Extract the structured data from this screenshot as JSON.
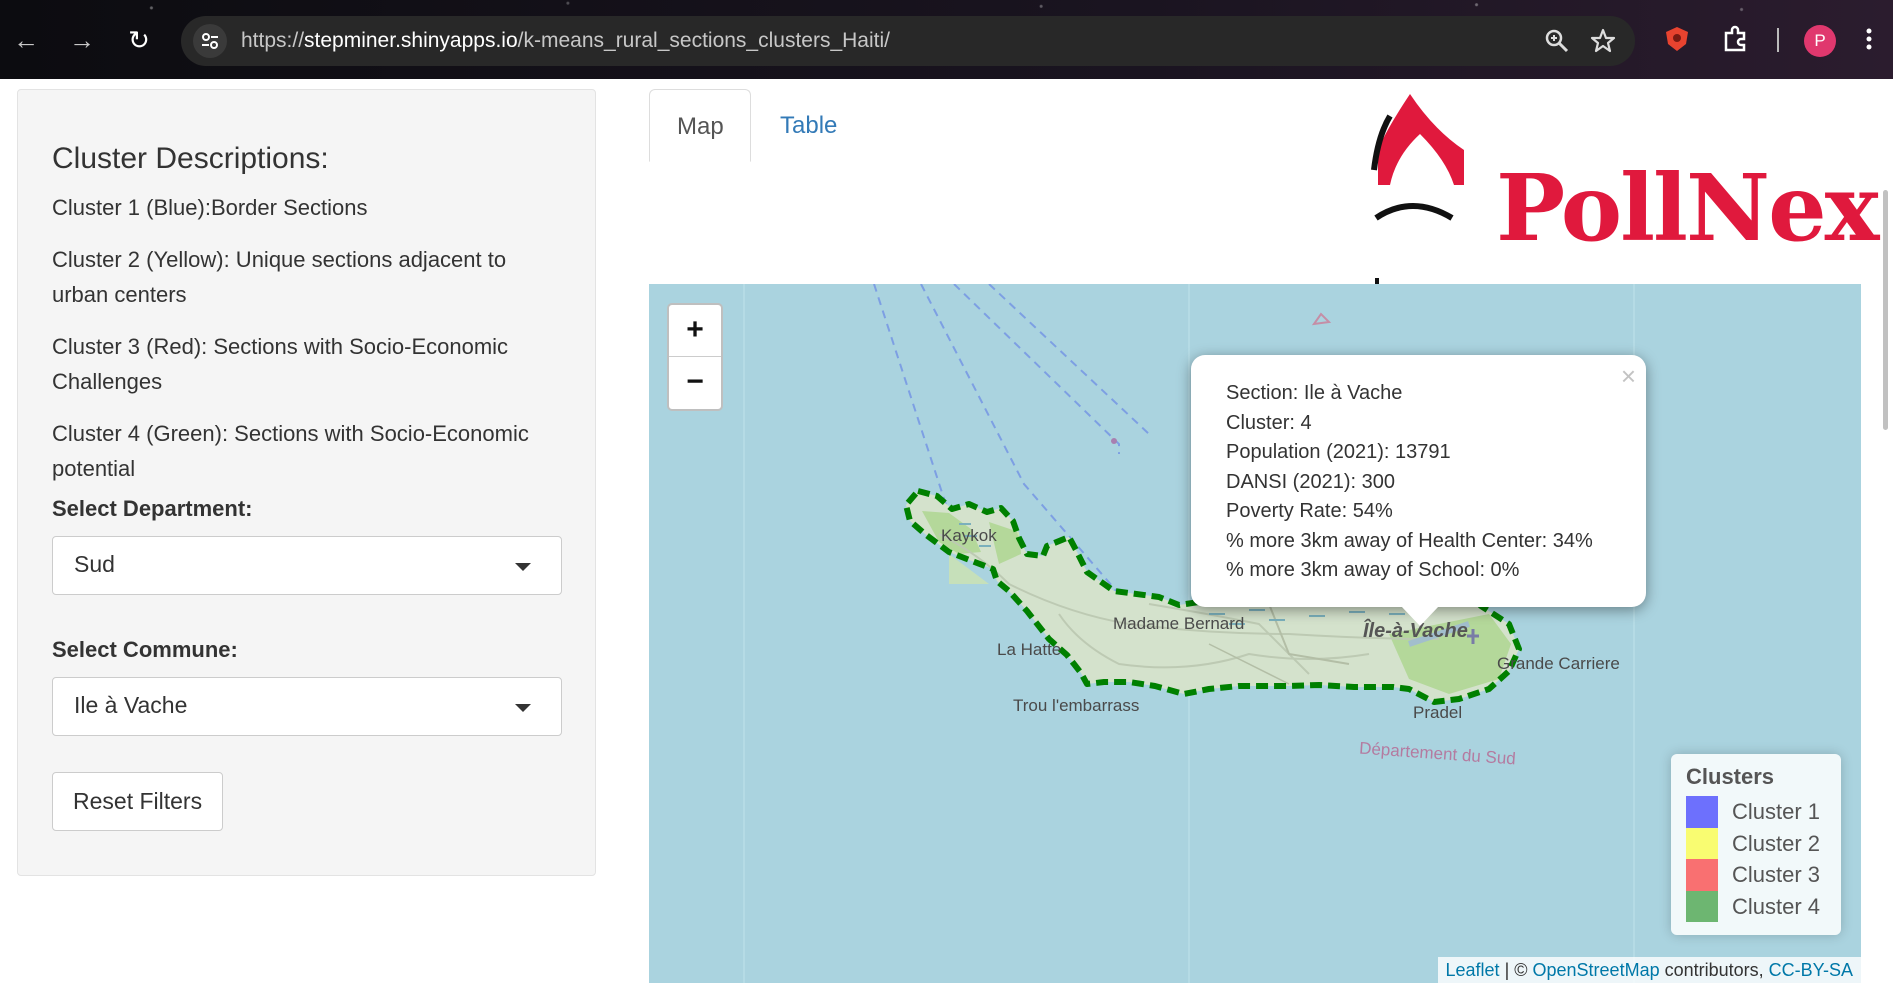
{
  "browser": {
    "url_scheme": "https://",
    "url_host": "stepminer.shinyapps.io",
    "url_path": "/k-means_rural_sections_clusters_Haiti/",
    "profile_initial": "P"
  },
  "sidebar": {
    "heading": "Cluster Descriptions:",
    "descriptions": [
      "Cluster 1 (Blue):Border Sections",
      "Cluster 2 (Yellow): Unique sections adjacent to urban centers",
      "Cluster 3 (Red): Sections with Socio-Economic Challenges",
      "Cluster 4 (Green): Sections with Socio-Economic potential"
    ],
    "department_label": "Select Department:",
    "department_value": "Sud",
    "commune_label": "Select Commune:",
    "commune_value": "Ile à Vache",
    "reset_label": "Reset Filters"
  },
  "tabs": {
    "map": "Map",
    "table": "Table"
  },
  "logo": {
    "text": "PollNex"
  },
  "map": {
    "zoom_in": "+",
    "zoom_out": "−",
    "labels": {
      "kaykok": "Kaykok",
      "madame_bernard": "Madame Bernard",
      "ile_a_vache": "Île-à-Vache",
      "la_hatte": "La Hatte",
      "trou_lembarrass": "Trou l'embarrass",
      "grande_carriere": "Grande Carriere",
      "pradel": "Pradel",
      "departement": "Département du Sud"
    },
    "popup": {
      "section": "Section: Ile à Vache",
      "cluster": "Cluster: 4",
      "population": "Population (2021): 13791",
      "dansi": "DANSI (2021): 300",
      "poverty": "Poverty Rate: 54%",
      "health": "% more 3km away of Health Center: 34%",
      "school": "% more 3km away of School: 0%",
      "close": "×"
    },
    "legend": {
      "title": "Clusters",
      "items": [
        {
          "label": "Cluster 1",
          "color": "#0000ff"
        },
        {
          "label": "Cluster 2",
          "color": "#ffff00"
        },
        {
          "label": "Cluster 3",
          "color": "#ff0000"
        },
        {
          "label": "Cluster 4",
          "color": "#008000"
        }
      ]
    },
    "attribution": {
      "leaflet": "Leaflet",
      "sep": " | © ",
      "osm": "OpenStreetMap",
      "contrib": " contributors, ",
      "license": "CC-BY-SA"
    },
    "outline_color": "#008000",
    "water_color": "#aad3df",
    "land_color": "#f2efe9"
  }
}
